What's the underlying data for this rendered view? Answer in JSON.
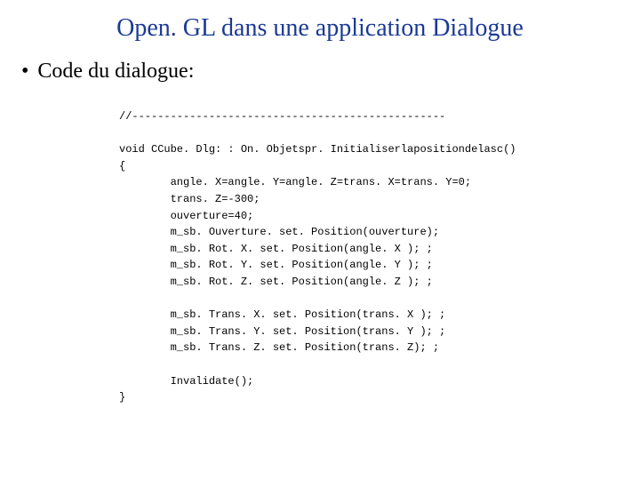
{
  "title": "Open. GL dans une application Dialogue",
  "bullet": {
    "dot": "•",
    "text": "Code du dialogue:"
  },
  "code": {
    "sep": "//-------------------------------------------------",
    "sig": "void CCube. Dlg: : On. Objetspr. Initialiserlapositiondelasc()",
    "open": "{",
    "l1": "        angle. X=angle. Y=angle. Z=trans. X=trans. Y=0;",
    "l2": "        trans. Z=-300;",
    "l3": "        ouverture=40;",
    "l4": "        m_sb. Ouverture. set. Position(ouverture);",
    "l5": "        m_sb. Rot. X. set. Position(angle. X ); ;",
    "l6": "        m_sb. Rot. Y. set. Position(angle. Y ); ;",
    "l7": "        m_sb. Rot. Z. set. Position(angle. Z ); ;",
    "l8": "        m_sb. Trans. X. set. Position(trans. X ); ;",
    "l9": "        m_sb. Trans. Y. set. Position(trans. Y ); ;",
    "l10": "        m_sb. Trans. Z. set. Position(trans. Z); ;",
    "l11": "        Invalidate();",
    "close": "}"
  }
}
